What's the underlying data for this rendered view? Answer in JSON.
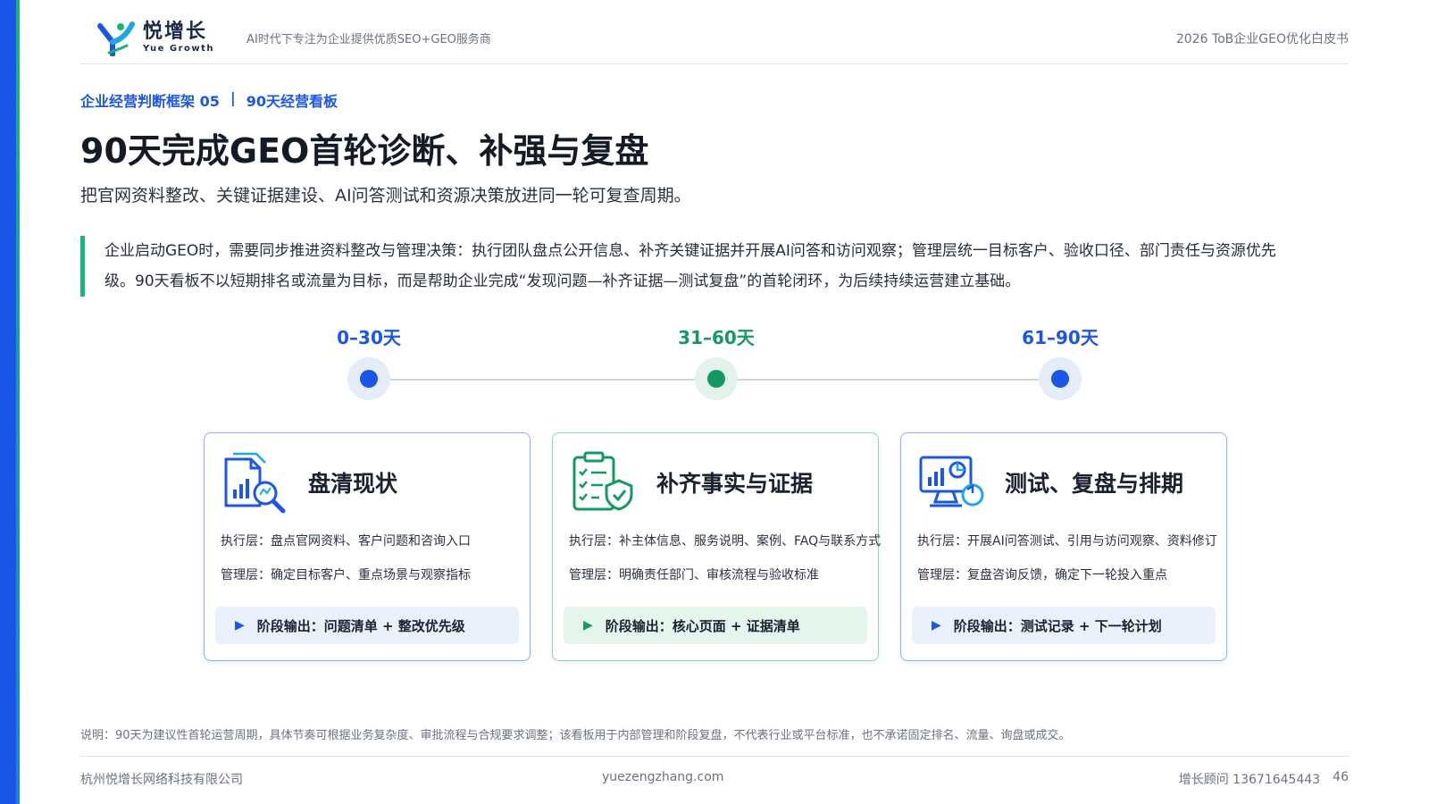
{
  "header": {
    "logo_cn": "悦增长",
    "logo_en": "Yue Growth",
    "tagline": "AI时代下专注为企业提供优质SEO+GEO服务商",
    "whitepaper": "2026 ToB企业GEO优化白皮书"
  },
  "eyebrow": {
    "part1": "企业经营判断框架 05",
    "sep": "|",
    "part2": "90天经营看板"
  },
  "title": "90天完成GEO首轮诊断、补强与复盘",
  "subtitle": "把官网资料整改、关键证据建设、AI问答测试和资源决策放进同一轮可复查周期。",
  "quote": "企业启动GEO时，需要同步推进资料整改与管理决策：执行团队盘点公开信息、补齐关键证据并开展AI问答和访问观察；管理层统一目标客户、验收口径、部门责任与资源优先级。90天看板不以短期排名或流量为目标，而是帮助企业完成“发现问题—补齐证据—测试复盘”的首轮闭环，为后续持续运营建立基础。",
  "timeline": [
    {
      "label": "0–30天",
      "color": "#1a56e8"
    },
    {
      "label": "31–60天",
      "color": "#139a63"
    },
    {
      "label": "61–90天",
      "color": "#1a56e8"
    }
  ],
  "cards": [
    {
      "title": "盘清现状",
      "exec": "执行层：盘点官网资料、客户问题和咨询入口",
      "mgmt": "管理层：确定目标客户、重点场景与观察指标",
      "output": "阶段输出：问题清单 + 整改优先级"
    },
    {
      "title": "补齐事实与证据",
      "exec": "执行层：补主体信息、服务说明、案例、FAQ与联系方式",
      "mgmt": "管理层：明确责任部门、审核流程与验收标准",
      "output": "阶段输出：核心页面 + 证据清单"
    },
    {
      "title": "测试、复盘与排期",
      "exec": "执行层：开展AI问答测试、引用与访问观察、资料修订",
      "mgmt": "管理层：复盘咨询反馈，确定下一轮投入重点",
      "output": "阶段输出：测试记录 + 下一轮计划"
    }
  ],
  "note": "说明：90天为建议性首轮运营周期，具体节奏可根据业务复杂度、审批流程与合规要求调整；该看板用于内部管理和阶段复盘，不代表行业或平台标准，也不承诺固定排名、流量、询盘或成交。",
  "footer": {
    "company": "杭州悦增长网络科技有限公司",
    "site": "yuezengzhang.com",
    "contact": "增长顾问 13671645443",
    "page": "46"
  },
  "icons": [
    "report-search-icon",
    "checklist-shield-icon",
    "monitor-chart-refresh-icon"
  ]
}
